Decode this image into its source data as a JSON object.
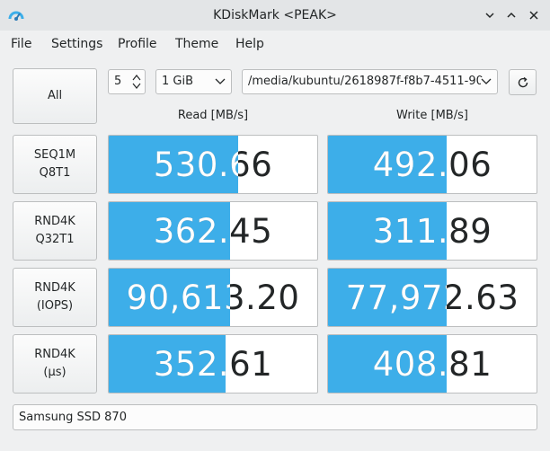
{
  "window": {
    "title": "KDiskMark <PEAK>"
  },
  "menu": [
    "File",
    "Settings",
    "Profile",
    "Theme",
    "Help"
  ],
  "controls": {
    "all_label": "All",
    "loops_value": "5",
    "size_value": "1 GiB",
    "path_value": "/media/kubuntu/2618987f-f8b7-4511-90"
  },
  "headers": {
    "read": "Read [MB/s]",
    "write": "Write [MB/s]"
  },
  "tests": [
    {
      "label": "SEQ1M\nQ8T1",
      "read": "530.66",
      "read_fraction": 0.62,
      "write": "492.06",
      "write_fraction": 0.57
    },
    {
      "label": "RND4K\nQ32T1",
      "read": "362.45",
      "read_fraction": 0.58,
      "write": "311.89",
      "write_fraction": 0.57
    },
    {
      "label": "RND4K\n(IOPS)",
      "read": "90,613.20",
      "read_fraction": 0.58,
      "write": "77,972.63",
      "write_fraction": 0.57
    },
    {
      "label": "RND4K\n(μs)",
      "read": "352.61",
      "read_fraction": 0.56,
      "write": "408.81",
      "write_fraction": 0.57
    }
  ],
  "device": "Samsung SSD 870",
  "colors": {
    "accent": "#3daee9",
    "window_bg": "#eff0f1",
    "titlebar_bg": "#e3e5e7"
  }
}
